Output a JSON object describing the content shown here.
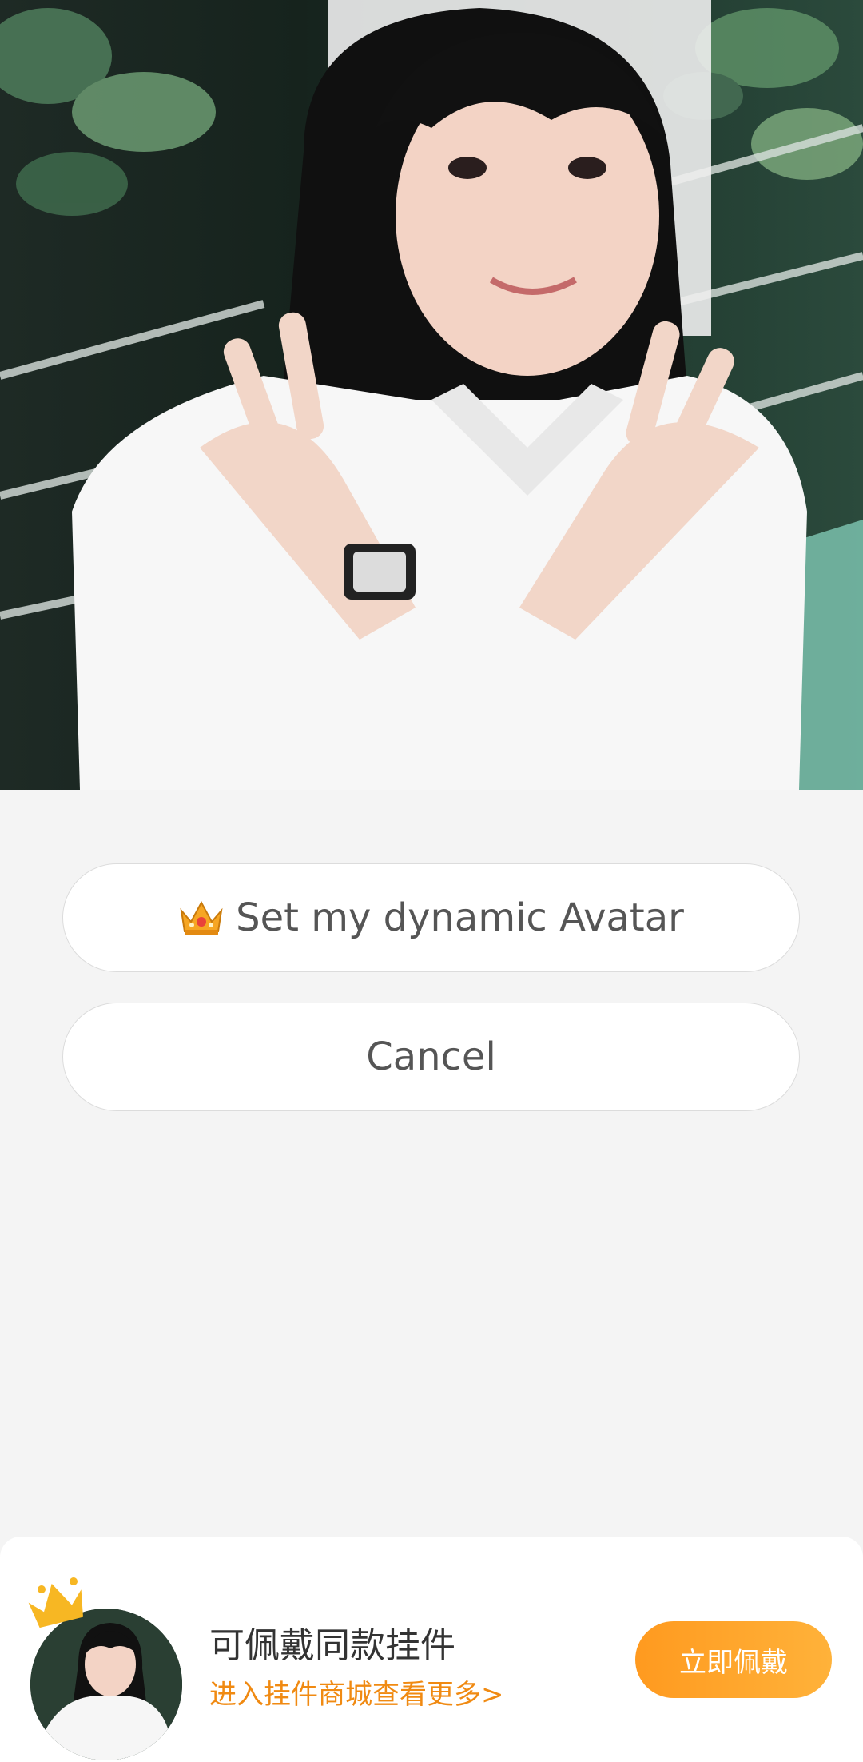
{
  "photo": {
    "icon": "portrait-photo"
  },
  "actions": {
    "set_avatar_label": "Set my dynamic Avatar",
    "set_avatar_icon": "crown-icon",
    "cancel_label": "Cancel"
  },
  "banner": {
    "title": "可佩戴同款挂件",
    "link": "进入挂件商城查看更多>",
    "wear_button": "立即佩戴",
    "accent_color": "#ff9a1f",
    "link_color": "#f08a12",
    "crown_icon": "crown-icon"
  }
}
